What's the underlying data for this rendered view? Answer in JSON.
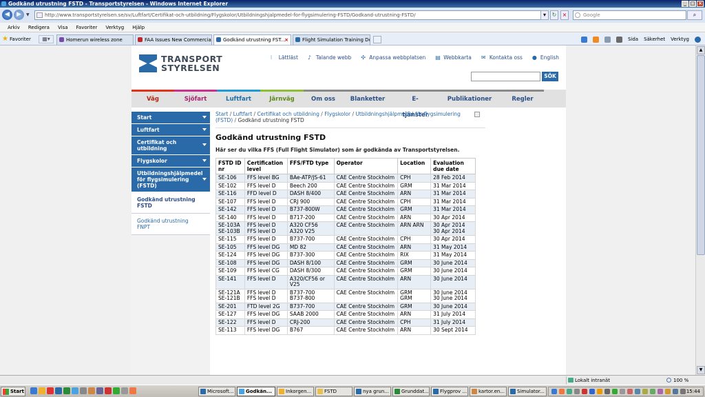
{
  "browser": {
    "title": "Godkänd utrustning FSTD - Transportstyrelsen - Windows Internet Explorer",
    "url": "http://www.transportstyrelsen.se/sv/Luftfart/Certifikat-och-utbildning/Flygskolor/Utbildningshjalpmedel-for-flygsimulering-FSTD/Godkand-utrustning-FSTD/",
    "search_placeholder": "Google",
    "menu": [
      "Arkiv",
      "Redigera",
      "Visa",
      "Favoriter",
      "Verktyg",
      "Hjälp"
    ],
    "favorites_label": "Favoriter",
    "tabs": [
      {
        "label": "Homerun wireless zone",
        "color": "#7a4aa8"
      },
      {
        "label": "FAA Issues New Commercial ...",
        "color": "#c0262d"
      },
      {
        "label": "Godkänd utrustning FST...",
        "color": "#2b6aa8"
      },
      {
        "label": "Flight Simulation Training De...",
        "color": "#2b6aa8"
      }
    ],
    "commands": [
      "Sida",
      "Säkerhet",
      "Verktyg"
    ],
    "status_zone": "Lokalt intranät",
    "zoom": "100 %"
  },
  "site": {
    "logo_line1": "TRANSPORT",
    "logo_line2": "STYRELSEN",
    "top_links": [
      "Lättläst",
      "Talande webb",
      "Anpassa webbplatsen",
      "Webbkarta",
      "Kontakta oss",
      "English"
    ],
    "search_button": "SÖK",
    "main_nav": [
      "Väg",
      "Sjöfart",
      "Luftfart",
      "Järnväg",
      "Om oss",
      "Blanketter",
      "E-tjänster",
      "Publikationer",
      "Regler"
    ],
    "sidebar": [
      {
        "label": "Start"
      },
      {
        "label": "Luftfart"
      },
      {
        "label": "Certifikat och utbildning"
      },
      {
        "label": "Flygskolor"
      },
      {
        "label": "Utbildningshjälpmedel för flygsimulering (FSTD)"
      },
      {
        "label": "Godkänd utrustning FSTD"
      },
      {
        "label": "Godkänd utrustning FNPT"
      }
    ]
  },
  "content": {
    "breadcrumb": [
      "Start",
      "Luftfart",
      "Certifikat och utbildning",
      "Flygskolor",
      "Utbildningshjälpmedel för flygsimulering (FSTD)"
    ],
    "breadcrumb_current": "Godkänd utrustning FSTD",
    "title": "Godkänd utrustning FSTD",
    "intro": "Här ser du vilka FFS (Full Flight Simulator) som är godkända av Transportstyrelsen.",
    "table_headers": [
      "FSTD ID nr",
      "Certification level",
      "FFS/FTD  type",
      "Operator",
      "Location",
      "Evaluation due date"
    ],
    "rows": [
      [
        "SE-106",
        "FFS level BG",
        "BAe-ATP/JS-61",
        "CAE Centre Stockholm",
        "CPH",
        "28 Feb 2014"
      ],
      [
        "SE-102",
        "FFS level D",
        "Beech 200",
        "CAE Centre Stockholm",
        "GRM",
        "31 Mar 2014"
      ],
      [
        "SE-116",
        "FFD level D",
        "DASH 8/400",
        "CAE Centre Stockholm",
        "ARN",
        "31 Mar 2014"
      ],
      [
        "SE-107",
        "FFS level D",
        "CRJ 900",
        "CAE Centre Stockholm",
        "CPH",
        "31 Mar 2014"
      ],
      [
        "SE-142",
        "FFS level D",
        "B737-800W",
        "CAE Centre Stockholm",
        "GRM",
        "31 Mar 2014"
      ],
      [
        "SE-140",
        "FFS level D",
        "B717-200",
        "CAE Centre Stockholm",
        "ARN",
        "30 Apr 2014"
      ],
      [
        "SE-103A\nSE-103B",
        "FFS level D\nFFS level D",
        "A320 CF56\nA320 V25",
        "CAE Centre Stockholm",
        "ARN ARN",
        "30 Apr 2014\n30 Apr 2014"
      ],
      [
        "SE-115",
        "FFS level D",
        "B737-700",
        "CAE Centre Stockholm",
        "CPH",
        "30 Apr 2014"
      ],
      [
        "SE-105",
        "FFS level DG",
        "MD 82",
        "CAE Centre Stockholm",
        "ARN",
        "31 May 2014"
      ],
      [
        "SE-124",
        "FFS level DG",
        "B737-300",
        "CAE Centre Stockholm",
        "RIX",
        "31 May 2014"
      ],
      [
        "SE-108",
        "FFS level DG",
        "DASH 8/100",
        "CAE Centre Stockholm",
        "GRM",
        "30 June 2014"
      ],
      [
        "SE-109",
        "FFS level CG",
        "DASH 8/300",
        "CAE Centre Stockholm",
        "GRM",
        "30 June 2014"
      ],
      [
        "SE-141",
        "FFS level D",
        "A320/CF56 or V25",
        "CAE Centre Stockholm",
        "ARN",
        "30 June 2014"
      ],
      [
        "SE-121A\nSE-121B",
        "FFS level D\nFFS level D",
        "B737-700\nB737-800",
        "CAE Centre Stockholm",
        "GRM\nGRM",
        "30 June 2014\n30 June 2014"
      ],
      [
        "SE-201",
        "FTD level 2G",
        "B737-700",
        "CAE Centre Stockholm",
        "GRM",
        "30 June 2014"
      ],
      [
        "SE-127",
        "FFS level DG",
        "SAAB 2000",
        "CAE Centre Stockholm",
        "ARN",
        "31 July 2014"
      ],
      [
        "SE-122",
        "FFS level D",
        "CRJ-200",
        "CAE Centre Stockholm",
        "CPH",
        "31 July 2014"
      ],
      [
        "SE-113",
        "FFS level DG",
        "B767",
        "CAE Centre Stockholm",
        "ARN",
        "30 Sept 2014"
      ]
    ]
  },
  "taskbar": {
    "start": "Start",
    "tasks": [
      "Microsoft...",
      "Godkän...",
      "Inkorgen...",
      "FSTD",
      "nya grun...",
      "Grunddat...",
      "Flygprov ...",
      "kartor.en...",
      "Simulator..."
    ],
    "clock": "15:44"
  }
}
